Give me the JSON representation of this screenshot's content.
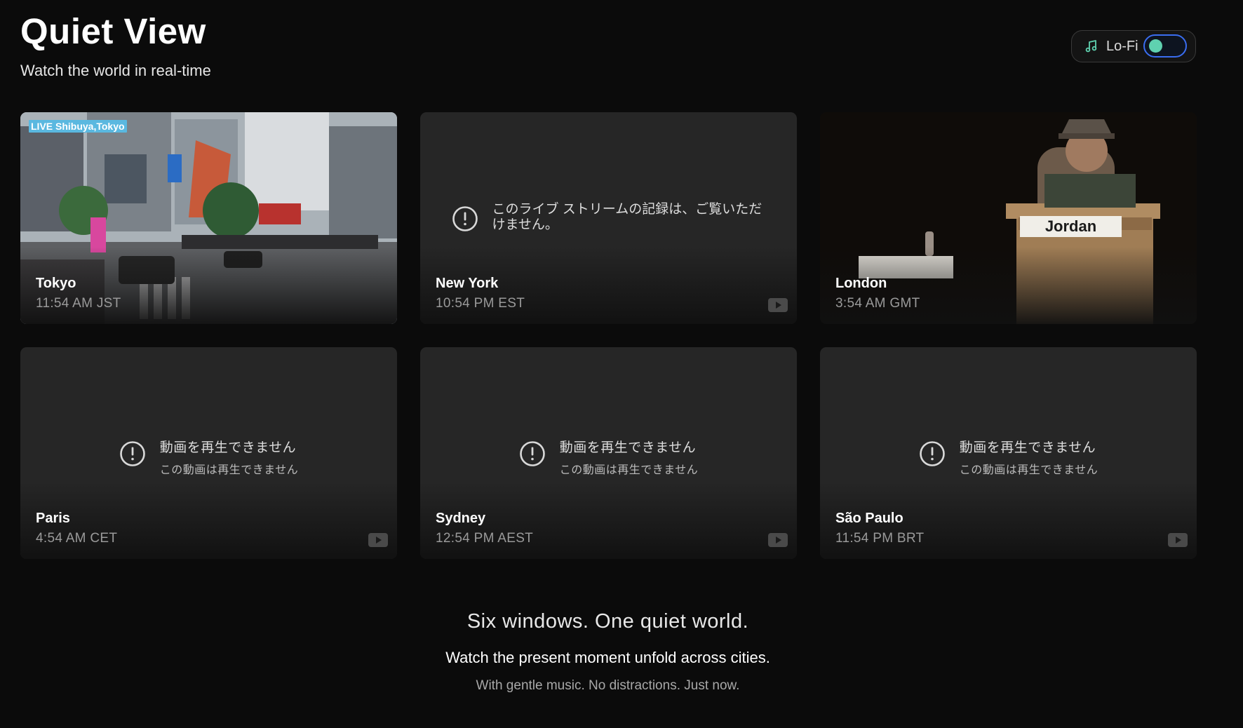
{
  "header": {
    "title": "Quiet View",
    "subtitle": "Watch the world in real-time"
  },
  "lofi": {
    "label": "Lo-Fi",
    "icon": "music-note-icon",
    "enabled": true,
    "knob_color": "#5fd1b0",
    "outline_color": "#3a6df0"
  },
  "cards": [
    {
      "city": "Tokyo",
      "time": "11:54 AM JST",
      "state": "live",
      "live_tag": "LIVE Shibuya,Tokyo"
    },
    {
      "city": "New York",
      "time": "10:54 PM EST",
      "state": "error",
      "error_line1": "このライブ ストリームの記録は、ご覧いただけません。",
      "error_line2": ""
    },
    {
      "city": "London",
      "time": "3:54 AM GMT",
      "state": "live",
      "sign_text": "Jordan"
    },
    {
      "city": "Paris",
      "time": "4:54 AM CET",
      "state": "error",
      "error_line1": "動画を再生できません",
      "error_line2": "この動画は再生できません"
    },
    {
      "city": "Sydney",
      "time": "12:54 PM AEST",
      "state": "error",
      "error_line1": "動画を再生できません",
      "error_line2": "この動画は再生できません"
    },
    {
      "city": "São Paulo",
      "time": "11:54 PM BRT",
      "state": "error",
      "error_line1": "動画を再生できません",
      "error_line2": "この動画は再生できません"
    }
  ],
  "footer": {
    "headline": "Six windows. One quiet world.",
    "line2": "Watch the present moment unfold across cities.",
    "line3": "With gentle music. No distractions. Just now."
  }
}
